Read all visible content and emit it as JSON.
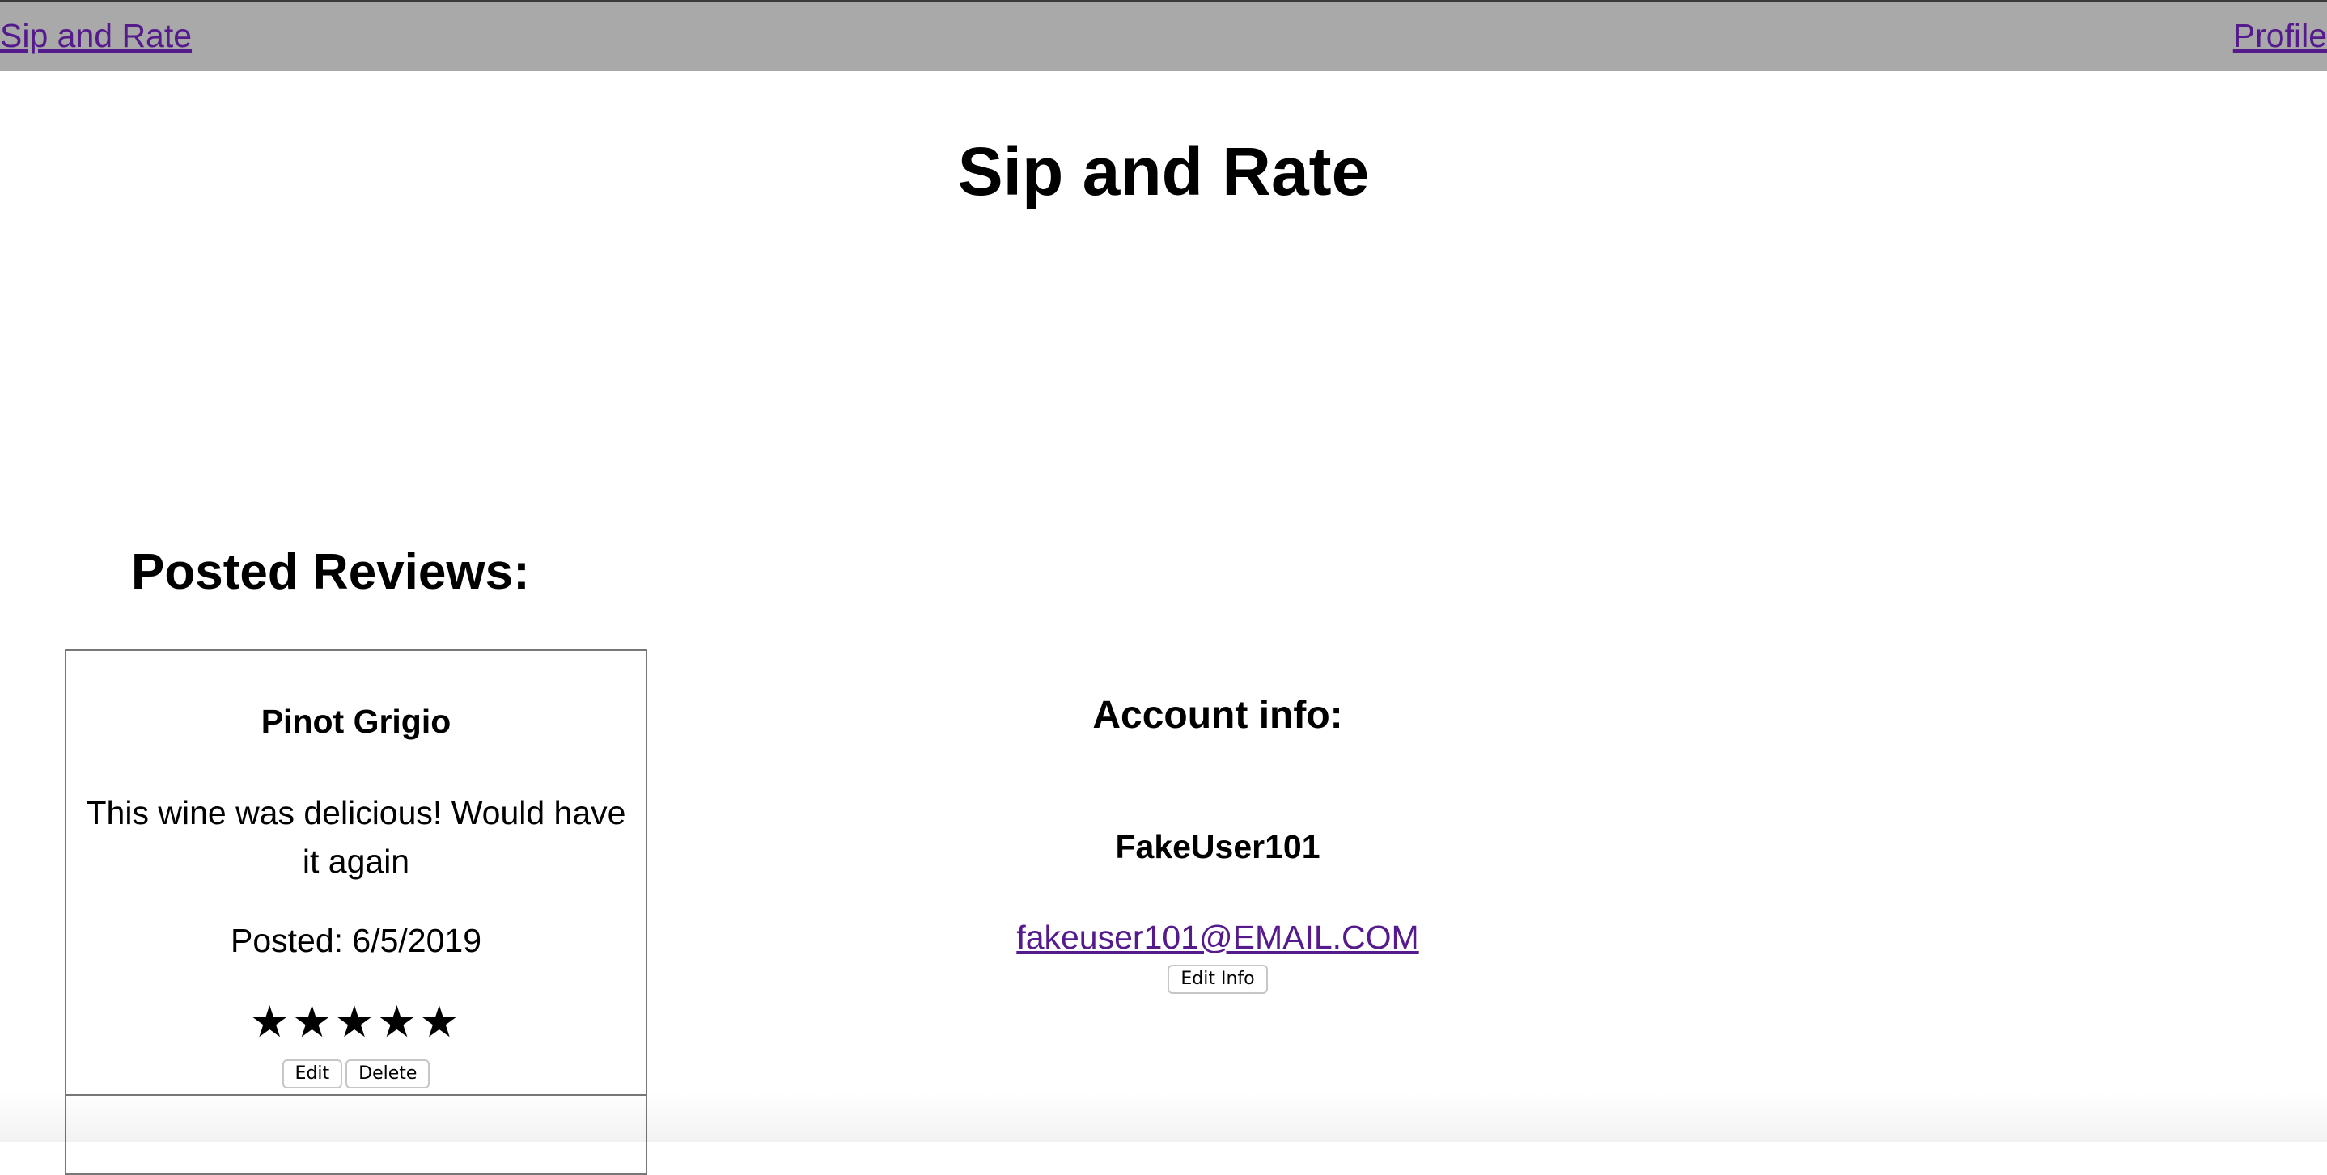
{
  "nav": {
    "home_label": "Sip and Rate",
    "profile_label": "Profile"
  },
  "page": {
    "title": "Sip and Rate"
  },
  "reviews": {
    "heading": "Posted Reviews:",
    "items": [
      {
        "wine": "Pinot Grigio",
        "text": "This wine was delicious! Would have it again",
        "posted": "Posted: 6/5/2019",
        "rating": 5,
        "stars_text": "★★★★★",
        "edit_label": "Edit",
        "delete_label": "Delete"
      }
    ]
  },
  "account": {
    "heading": "Account info:",
    "username": "FakeUser101",
    "email": "fakeuser101@EMAIL.COM",
    "edit_label": "Edit Info"
  },
  "colors": {
    "navbar_bg": "#a9a9a9",
    "link": "#551a8b"
  }
}
